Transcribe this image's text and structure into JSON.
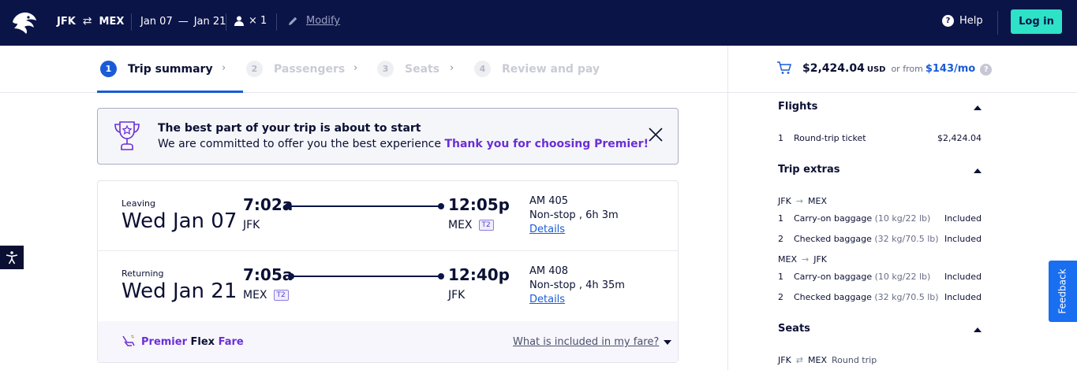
{
  "header": {
    "origin": "JFK",
    "destination": "MEX",
    "depart_date": "Jan 07",
    "date_sep": "—",
    "return_date": "Jan 21",
    "passengers": "× 1",
    "modify_label": "Modify",
    "help_label": "Help",
    "login_label": "Log in"
  },
  "steps": [
    {
      "num": "1",
      "label": "Trip summary"
    },
    {
      "num": "2",
      "label": "Passengers"
    },
    {
      "num": "3",
      "label": "Seats"
    },
    {
      "num": "4",
      "label": "Review and pay"
    }
  ],
  "banner": {
    "title": "The best part of your trip is about to start",
    "text": "We are committed to offer you the best experience",
    "highlight": "Thank you for choosing Premier!"
  },
  "legs": [
    {
      "kind": "Leaving",
      "date": "Wed Jan 07",
      "dep_time": "7:02a",
      "dep_airport": "JFK",
      "dep_terminal": "",
      "arr_time": "12:05p",
      "arr_airport": "MEX",
      "arr_terminal": "T2",
      "flight": "AM 405",
      "stops": "Non-stop , 6h 3m",
      "details": "Details"
    },
    {
      "kind": "Returning",
      "date": "Wed Jan 21",
      "dep_time": "7:05a",
      "dep_airport": "MEX",
      "dep_terminal": "T2",
      "arr_time": "12:40p",
      "arr_airport": "JFK",
      "arr_terminal": "",
      "flight": "AM 408",
      "stops": "Non-stop , 4h 35m",
      "details": "Details"
    }
  ],
  "fare": {
    "brand": "Premier",
    "flex": "Flex",
    "fare": "Fare",
    "link": "What is included in my fare?"
  },
  "summary": {
    "total": "$2,424.04",
    "currency": "USD",
    "or_from": "or from",
    "monthly": "$143/mo",
    "flights_title": "Flights",
    "flights_items": [
      {
        "n": "1",
        "label": "Round-trip ticket",
        "amount": "$2,424.04"
      }
    ],
    "extras_title": "Trip extras",
    "extras_route1": {
      "from": "JFK",
      "to": "MEX"
    },
    "extras_route1_items": [
      {
        "n": "1",
        "label": "Carry-on baggage",
        "detail": "(10 kg/22 lb)",
        "amount": "Included"
      },
      {
        "n": "2",
        "label": "Checked baggage",
        "detail": "(32 kg/70.5 lb)",
        "amount": "Included"
      }
    ],
    "extras_route2": {
      "from": "MEX",
      "to": "JFK"
    },
    "extras_route2_items": [
      {
        "n": "1",
        "label": "Carry-on baggage",
        "detail": "(10 kg/22 lb)",
        "amount": "Included"
      },
      {
        "n": "2",
        "label": "Checked baggage",
        "detail": "(32 kg/70.5 lb)",
        "amount": "Included"
      }
    ],
    "seats_title": "Seats",
    "seats_route": {
      "from": "JFK",
      "to": "MEX",
      "type": "Round trip"
    }
  },
  "widgets": {
    "feedback": "Feedback"
  },
  "colors": {
    "nav_bg": "#0b1447",
    "accent_blue": "#1a5bd7",
    "login_teal": "#2ee2c7",
    "premier_purple": "#6b2fd6"
  }
}
